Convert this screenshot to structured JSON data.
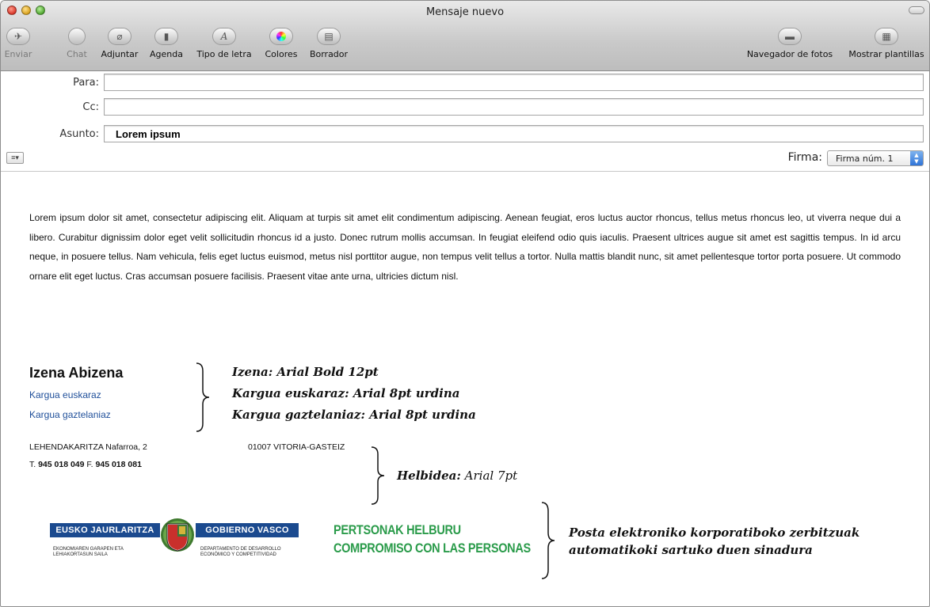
{
  "window": {
    "title": "Mensaje nuevo"
  },
  "toolbar": {
    "items": [
      {
        "label": "Enviar",
        "enabled": false
      },
      {
        "label": "Chat",
        "enabled": false
      },
      {
        "label": "Adjuntar",
        "enabled": true
      },
      {
        "label": "Agenda",
        "enabled": true
      },
      {
        "label": "Tipo de letra",
        "enabled": true
      },
      {
        "label": "Colores",
        "enabled": true
      },
      {
        "label": "Borrador",
        "enabled": true
      },
      {
        "label": "Navegador de fotos",
        "enabled": true
      },
      {
        "label": "Mostrar plantillas",
        "enabled": true
      }
    ]
  },
  "headers": {
    "to_label": "Para:",
    "to_value": "",
    "cc_label": "Cc:",
    "cc_value": "",
    "subject_label": "Asunto:",
    "subject_value": "Lorem ipsum",
    "signature_label": "Firma:",
    "signature_value": "Firma núm. 1"
  },
  "body": {
    "text": "Lorem ipsum dolor sit amet, consectetur adipiscing elit. Aliquam at turpis sit amet elit condimentum adipiscing. Aenean feugiat, eros luctus auctor rhoncus, tellus metus rhoncus leo, ut viverra neque dui a libero. Curabitur dignissim dolor eget velit sollicitudin rhoncus id a justo. Donec rutrum mollis accumsan. In feugiat eleifend odio quis iaculis. Praesent ultrices augue sit amet est sagittis tempus. In id arcu neque, in posuere tellus. Nam vehicula, felis eget luctus euismod, metus nisl porttitor augue, non tempus velit tellus a tortor. Nulla mattis blandit nunc, sit amet pellentesque tortor porta posuere. Ut commodo ornare elit eget luctus. Cras accumsan posuere facilisis. Praesent vitae ante urna, ultricies dictum nisl."
  },
  "signature": {
    "name": "Izena Abizena",
    "role_eu": "Kargua euskaraz",
    "role_es": "Kargua gaztelaniaz",
    "address": "LEHENDAKARITZA Nafarroa, 2",
    "city": "01007 VITORIA-GASTEIZ",
    "phone_prefix": "T.",
    "phone": "945 018 049",
    "fax_prefix": "F.",
    "fax": "945 018 081"
  },
  "annotations": {
    "name_note": "Izena: Arial Bold 12pt",
    "role_eu_note": "Kargua euskaraz: Arial 8pt urdina",
    "role_es_note": "Kargua gaztelaniaz: Arial 8pt urdina",
    "address_note_bold": "Helbidea:",
    "address_note_plain": " Arial 7pt",
    "auto_note_line1": "Posta elektroniko korporatiboko zerbitzuak",
    "auto_note_line2": "automatikoki sartuko duen sinadura"
  },
  "logos": {
    "eusko": "EUSKO JAURLARITZA",
    "gobierno": "GOBIERNO VASCO",
    "dept_eu_1": "EKONOMIAREN GARAPEN ETA",
    "dept_eu_2": "LEHIAKORTASUN SAILA",
    "dept_es_1": "DEPARTAMENTO DE DESARROLLO",
    "dept_es_2": "ECONÓMICO Y COMPETITIVIDAD",
    "slogan_1": "PERTSONAK HELBURU",
    "slogan_2": "COMPROMISO CON LAS PERSONAS"
  },
  "colors": {
    "role_blue": "#1f4f9a",
    "logo_blue": "#1b4a8f",
    "slogan_green": "#2a9b4a"
  }
}
